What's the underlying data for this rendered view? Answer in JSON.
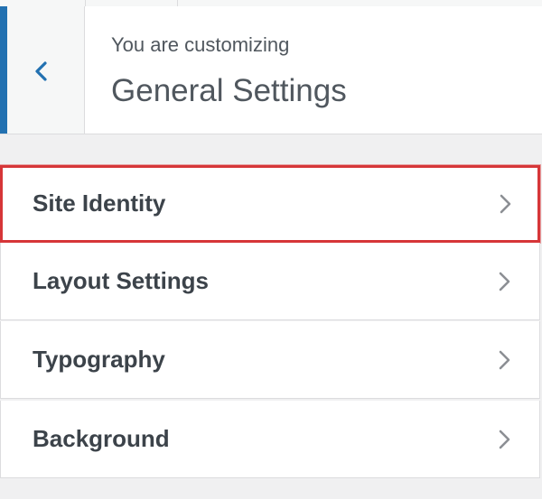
{
  "header": {
    "subtitle": "You are customizing",
    "title": "General Settings",
    "back_icon": "chevron-left-icon"
  },
  "sections": [
    {
      "label": "Site Identity",
      "icon": "chevron-right-icon",
      "highlighted": true
    },
    {
      "label": "Layout Settings",
      "icon": "chevron-right-icon",
      "highlighted": false
    },
    {
      "label": "Typography",
      "icon": "chevron-right-icon",
      "highlighted": false
    },
    {
      "label": "Background",
      "icon": "chevron-right-icon",
      "highlighted": false
    }
  ],
  "colors": {
    "accent": "#2271b1",
    "highlight_border": "#d63638",
    "text": "#3c434a",
    "muted_text": "#50575e",
    "background": "#f0f0f1"
  }
}
